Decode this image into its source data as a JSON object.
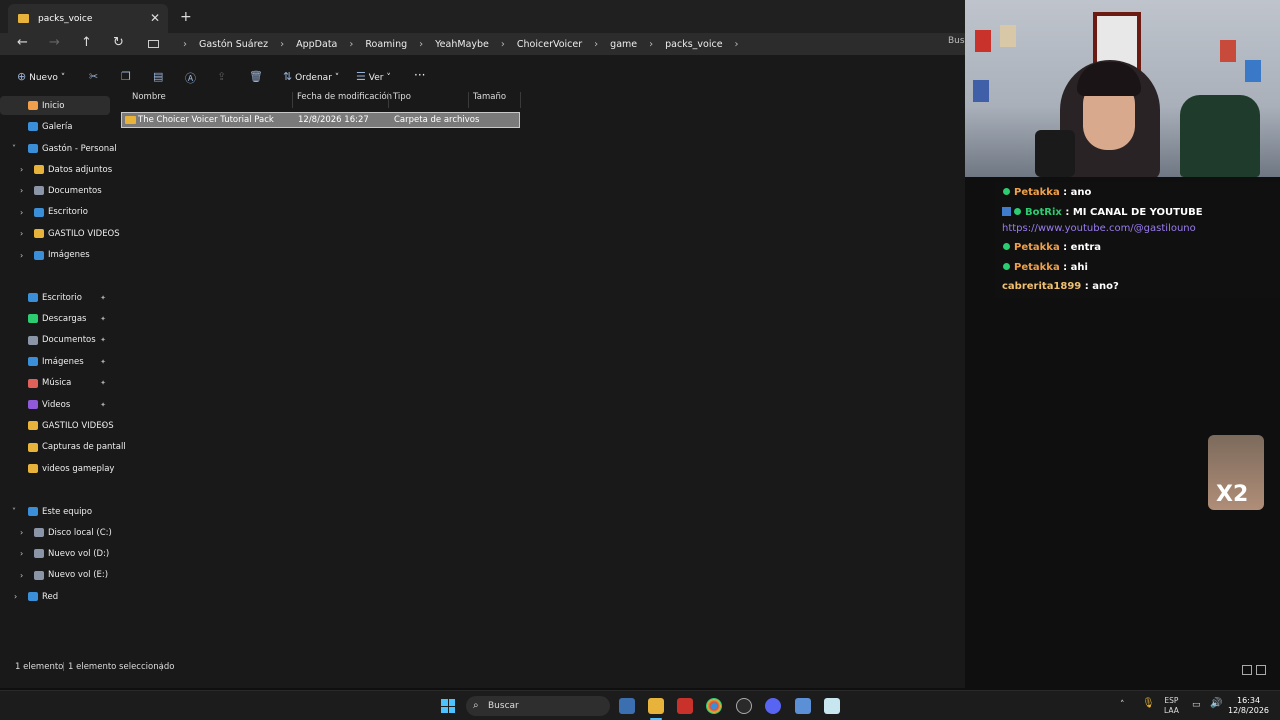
{
  "window": {
    "tab_title": "packs_voice",
    "close_glyph": "✕",
    "newtab_glyph": "+"
  },
  "address": {
    "back": "←",
    "forward": "→",
    "up": "↑",
    "refresh": "↻",
    "crumbs": [
      "Gastón Suárez",
      "AppData",
      "Roaming",
      "YeahMaybe",
      "ChoicerVoicer",
      "game",
      "packs_voice"
    ],
    "search_placeholder": "Busc"
  },
  "toolbar": {
    "new_label": "Nuevo",
    "sort_label": "Ordenar",
    "view_label": "Ver",
    "more_glyph": "···"
  },
  "sidebar": {
    "items": [
      {
        "label": "Inicio",
        "icon": "home-icon",
        "color": "#f0a04a"
      },
      {
        "label": "Galería",
        "icon": "gallery-icon",
        "color": "#3b8fd9"
      },
      {
        "label": "Gastón - Personal",
        "icon": "cloud-icon",
        "color": "#3b8fd9"
      },
      {
        "label": "Datos adjuntos",
        "icon": "folder-icon",
        "color": "#e8b33a"
      },
      {
        "label": "Documentos",
        "icon": "document-icon",
        "color": "#8a96a8"
      },
      {
        "label": "Escritorio",
        "icon": "desktop-icon",
        "color": "#3b8fd9"
      },
      {
        "label": "GASTILO VIDEOS",
        "icon": "folder-icon",
        "color": "#e8b33a"
      },
      {
        "label": "Imágenes",
        "icon": "pictures-icon",
        "color": "#3b8fd9"
      }
    ],
    "quick": [
      {
        "label": "Escritorio",
        "icon": "desktop-icon",
        "color": "#3b8fd9"
      },
      {
        "label": "Descargas",
        "icon": "download-icon",
        "color": "#2ecc71"
      },
      {
        "label": "Documentos",
        "icon": "document-icon",
        "color": "#8a96a8"
      },
      {
        "label": "Imágenes",
        "icon": "pictures-icon",
        "color": "#3b8fd9"
      },
      {
        "label": "Música",
        "icon": "music-icon",
        "color": "#e0605a"
      },
      {
        "label": "Videos",
        "icon": "video-icon",
        "color": "#8e5ad9"
      },
      {
        "label": "GASTILO VIDEOS",
        "icon": "folder-icon",
        "color": "#e8b33a"
      },
      {
        "label": "Capturas de pantall",
        "icon": "folder-icon",
        "color": "#e8b33a"
      },
      {
        "label": "videos gameplay",
        "icon": "folder-icon",
        "color": "#e8b33a"
      }
    ],
    "pc": [
      {
        "label": "Este equipo",
        "icon": "computer-icon",
        "color": "#3b8fd9"
      },
      {
        "label": "Disco local (C:)",
        "icon": "drive-icon",
        "color": "#8a96a8"
      },
      {
        "label": "Nuevo vol (D:)",
        "icon": "drive-icon",
        "color": "#8a96a8"
      },
      {
        "label": "Nuevo vol (E:)",
        "icon": "drive-icon",
        "color": "#8a96a8"
      },
      {
        "label": "Red",
        "icon": "network-icon",
        "color": "#3b8fd9"
      }
    ],
    "pin_glyph": "📌"
  },
  "columns": [
    "Nombre",
    "Fecha de modificación",
    "Tipo",
    "Tamaño"
  ],
  "files": [
    {
      "name": "The Choicer Voicer Tutorial Pack",
      "date": "12/8/2026 16:27",
      "type": "Carpeta de archivos",
      "size": ""
    }
  ],
  "status": {
    "count": "1 elemento",
    "selected": "1 elemento seleccionado"
  },
  "chat": [
    {
      "user": "Petakka",
      "text": " : ano",
      "color": "#f0a04a",
      "dot": true,
      "badge": false
    },
    {
      "user": "BotRix",
      "text": " : MI CANAL DE YOUTUBE",
      "color": "#2ecc71",
      "dot": true,
      "badge": true
    },
    {
      "user": "",
      "text": "https://www.youtube.com/@gastilouno",
      "color": "#9a7cf0",
      "dot": false,
      "badge": false
    },
    {
      "user": "Petakka",
      "text": " : entra",
      "color": "#f0a04a",
      "dot": true,
      "badge": false
    },
    {
      "user": "Petakka",
      "text": " : ahi",
      "color": "#f0a04a",
      "dot": true,
      "badge": false
    },
    {
      "user": "cabrerita1899",
      "text": " : ano?",
      "color": "#f0c070",
      "dot": false,
      "badge": false
    }
  ],
  "overlay": {
    "multiplier": "X2"
  },
  "taskbar": {
    "search": "Buscar",
    "lang_top": "ESP",
    "lang_bottom": "LAA",
    "time": "16:34",
    "date": "12/8/2026"
  }
}
